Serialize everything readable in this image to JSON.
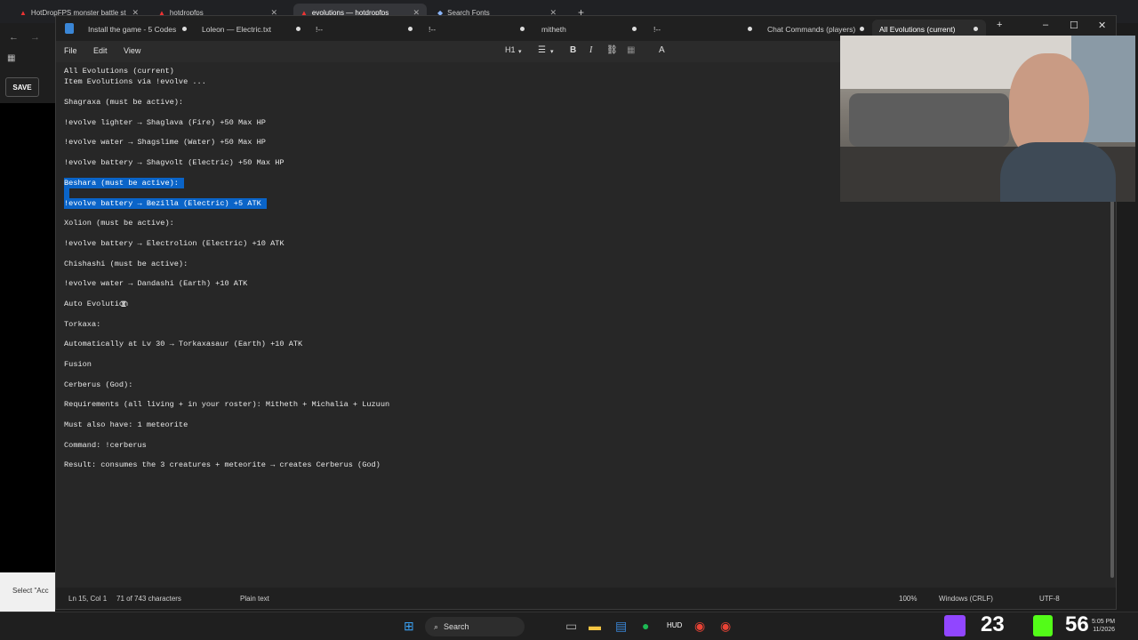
{
  "browser": {
    "tabs": [
      {
        "label": "HotDropFPS monster battle st"
      },
      {
        "label": "hotdropfps"
      },
      {
        "label": "evolutions — hotdropfps"
      },
      {
        "label": "Search Fonts"
      }
    ],
    "save_label": "SAVE",
    "select_label": "Select \"Acc"
  },
  "notepad": {
    "tabs": [
      {
        "label": "Install the game - 5 Codes"
      },
      {
        "label": "Loleon — Electric.txt"
      },
      {
        "label": "!--"
      },
      {
        "label": "!--"
      },
      {
        "label": "mitheth"
      },
      {
        "label": "!--"
      },
      {
        "label": "Chat Commands (players)"
      },
      {
        "label": "All Evolutions (current)"
      }
    ],
    "menu": {
      "file": "File",
      "edit": "Edit",
      "view": "View"
    },
    "toolbar": {
      "heading": "H1"
    },
    "lines": [
      "All Evolutions (current)",
      "Item Evolutions via !evolve ...",
      "Shagraxa (must be active):",
      "!evolve lighter → Shaglava (Fire) +50 Max HP",
      "!evolve water → Shagslime (Water) +50 Max HP",
      "!evolve battery → Shagvolt (Electric) +50 Max HP",
      "Beshara (must be active):",
      "!evolve battery → Bezilla (Electric) +5 ATK",
      "Xolion (must be active):",
      "!evolve battery → Electrolion (Electric) +10 ATK",
      "Chishashi (must be active):",
      "!evolve water → Dandashi (Earth) +10 ATK",
      "Auto Evolution",
      "Torkaxa:",
      "Automatically at Lv 30 → Torkaxasaur (Earth) +10 ATK",
      "Fusion",
      "Cerberus (God):",
      "Requirements (all living + in your roster): Mitheth + Michalia + Luzuun",
      "Must also have: 1 meteorite",
      "Command: !cerberus",
      "Result: consumes the 3 creatures + meteorite → creates Cerberus (God)"
    ],
    "status": {
      "position": "Ln 15, Col 1",
      "chars": "71 of 743 characters",
      "format": "Plain text",
      "zoom": "100%",
      "eol": "Windows (CRLF)",
      "encoding": "UTF-8"
    }
  },
  "taskbar": {
    "search": "Search",
    "counter_a": "23",
    "counter_b": "56",
    "time": "5:05 PM",
    "date": "11/2026"
  },
  "colors": {
    "selection": "#0a64c8",
    "accent_twitch": "#9146ff",
    "accent_kick": "#53fc18"
  }
}
